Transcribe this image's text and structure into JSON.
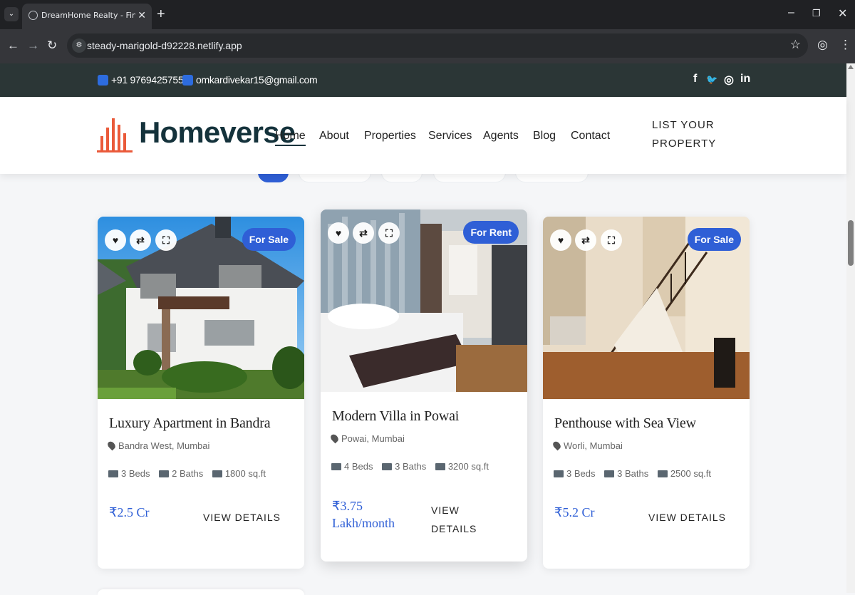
{
  "browser": {
    "tab_title": "DreamHome Realty - Find Your",
    "url": "steady-marigold-d92228.netlify.app"
  },
  "topbar": {
    "phone": "+91 9769425755",
    "email": "omkardivekar15@gmail.com",
    "social": [
      "f",
      "🐦",
      "◎",
      "in"
    ]
  },
  "header": {
    "logo": "Homeverse",
    "nav": [
      "Home",
      "About",
      "Properties",
      "Services",
      "Agents",
      "Blog",
      "Contact"
    ],
    "cta_line1": "LIST YOUR",
    "cta_line2": "PROPERTY"
  },
  "colors": {
    "accent": "#2f5fd6",
    "dark": "#14323b",
    "logo_orange": "#ea5a3a"
  },
  "listings": [
    {
      "badge": "For Sale",
      "title": "Luxury Apartment in Bandra",
      "location": "Bandra West, Mumbai",
      "beds": "3 Beds",
      "baths": "2 Baths",
      "area": "1800 sq.ft",
      "price": "₹2.5 Cr",
      "price_line2": "",
      "cta_line1": "VIEW DETAILS",
      "cta_line2": ""
    },
    {
      "badge": "For Rent",
      "title": "Modern Villa in Powai",
      "location": "Powai, Mumbai",
      "beds": "4 Beds",
      "baths": "3 Baths",
      "area": "3200 sq.ft",
      "price": "₹3.75",
      "price_line2": "Lakh/month",
      "cta_line1": "VIEW",
      "cta_line2": "DETAILS"
    },
    {
      "badge": "For Sale",
      "title": "Penthouse with Sea View",
      "location": "Worli, Mumbai",
      "beds": "3 Beds",
      "baths": "3 Baths",
      "area": "2500 sq.ft",
      "price": "₹5.2 Cr",
      "price_line2": "",
      "cta_line1": "VIEW DETAILS",
      "cta_line2": ""
    }
  ]
}
